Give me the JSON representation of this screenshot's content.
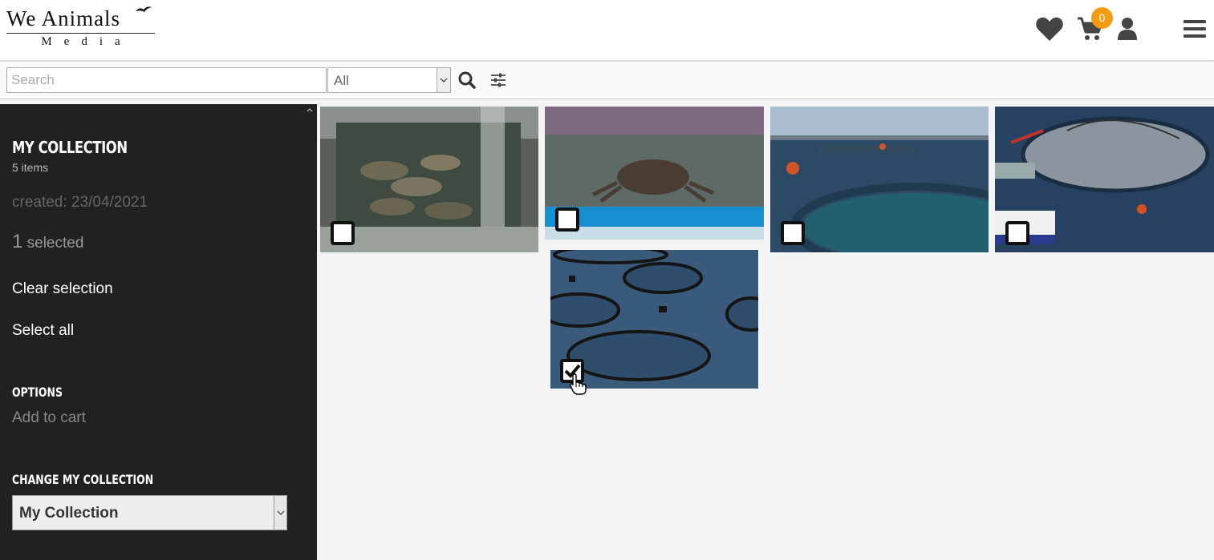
{
  "header": {
    "logo_top": "We Animals",
    "logo_bottom": "Media",
    "cart_count": "0",
    "icons": [
      "heart-icon",
      "cart-icon",
      "user-icon",
      "menu-icon"
    ]
  },
  "search": {
    "placeholder": "Search",
    "category_selected": "All"
  },
  "sidebar": {
    "title": "My Collection",
    "item_count": "5 items",
    "created": "created: 23/04/2021",
    "selected_num": "1",
    "selected_label": " selected",
    "clear_selection": "Clear selection",
    "select_all": "Select all",
    "options_title": "Options",
    "add_to_cart": "Add to cart",
    "change_title": "Change My Collection",
    "collection_selected": "My Collection"
  },
  "thumbnails": [
    {
      "name": "fish-tank",
      "checked": false
    },
    {
      "name": "crab-tank",
      "checked": false
    },
    {
      "name": "fish-farm-pens",
      "checked": false
    },
    {
      "name": "fish-farm-boat",
      "checked": false
    },
    {
      "name": "circular-pens",
      "checked": true
    }
  ],
  "colors": {
    "sidebar_bg": "#212121",
    "badge": "#f39c12",
    "page_bg": "#f4f4f4"
  }
}
